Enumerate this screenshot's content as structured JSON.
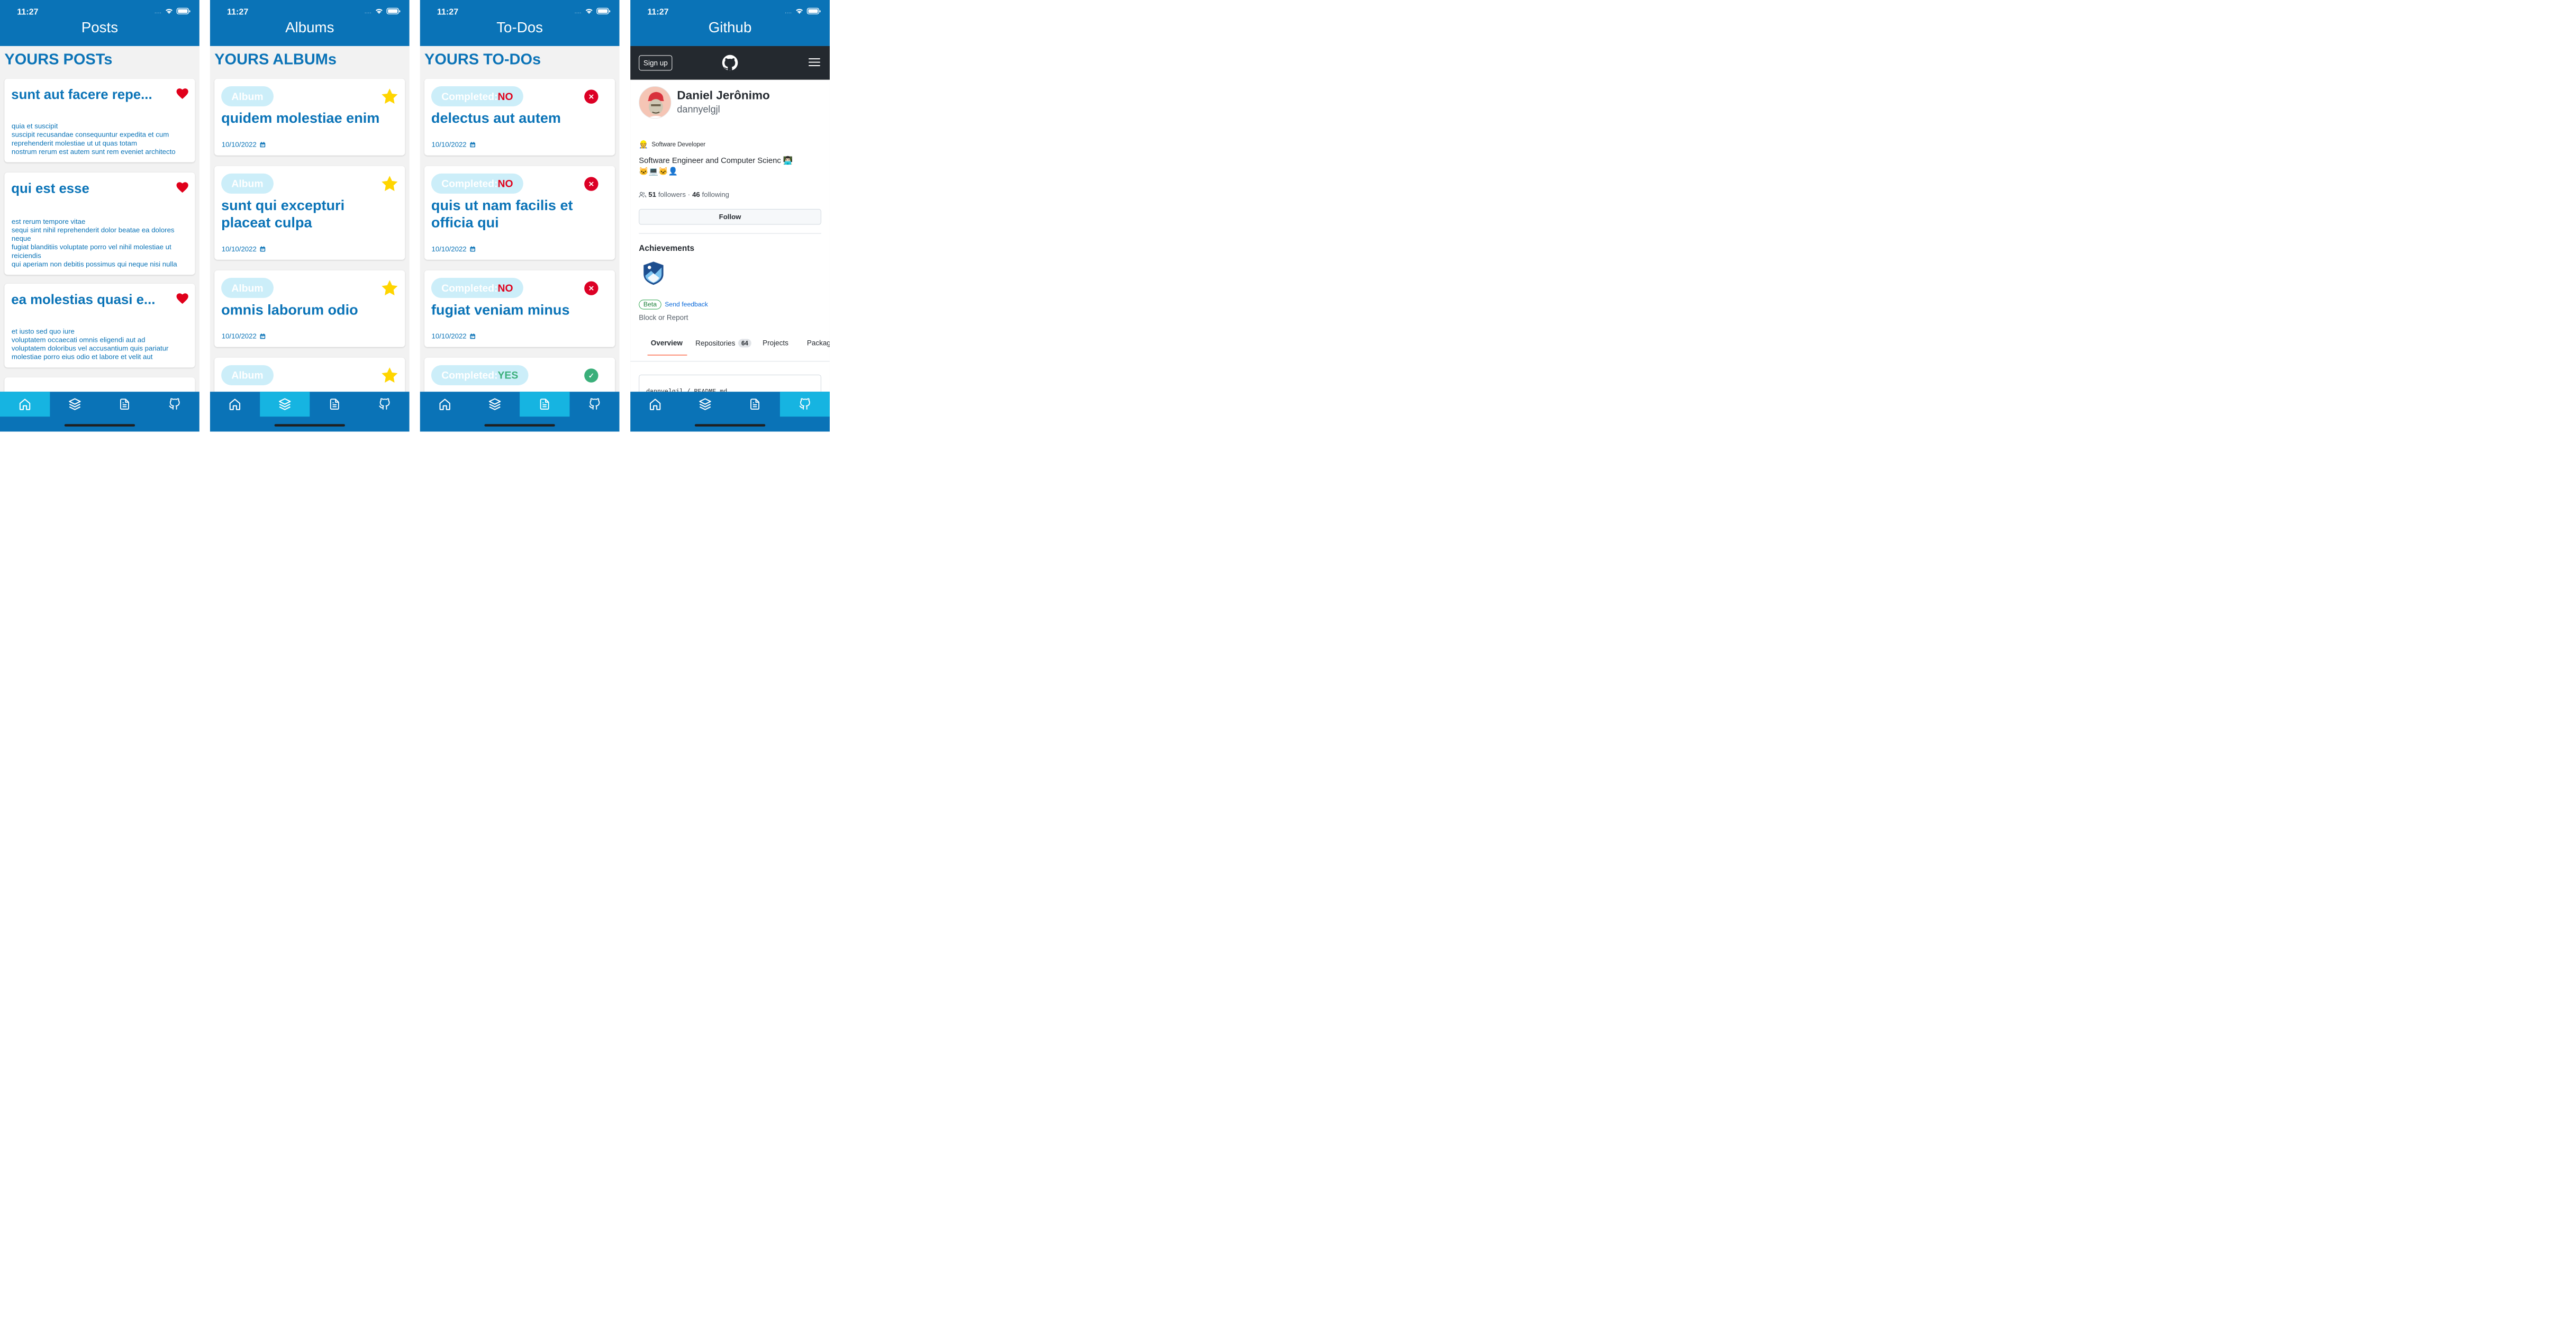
{
  "status": {
    "time": "11:27"
  },
  "posts_screen": {
    "title": "Posts",
    "section": "YOURS POSTs",
    "items": [
      {
        "title": "sunt aut facere repe...",
        "body": [
          "quia et suscipit",
          "suscipit recusandae consequuntur expedita et cum",
          "reprehenderit molestiae ut ut quas totam",
          "nostrum rerum est autem sunt rem eveniet architecto"
        ]
      },
      {
        "title": "qui est esse",
        "body": [
          "est rerum tempore vitae",
          "sequi sint nihil reprehenderit dolor beatae ea dolores",
          "neque",
          "fugiat blanditiis voluptate porro vel nihil molestiae ut",
          "reiciendis",
          "qui aperiam non debitis possimus qui neque nisi nulla"
        ]
      },
      {
        "title": "ea molestias quasi e...",
        "body": [
          "et iusto sed quo iure",
          "voluptatem occaecati omnis eligendi aut ad",
          "voluptatem doloribus vel accusantium quis pariatur",
          "molestiae porro eius odio et labore et velit aut"
        ]
      }
    ]
  },
  "albums_screen": {
    "title": "Albums",
    "section": "YOURS ALBUMs",
    "badge_label": "Album",
    "items": [
      {
        "title": "quidem molestiae enim",
        "date": "10/10/2022"
      },
      {
        "title": "sunt qui excepturi placeat culpa",
        "date": "10/10/2022"
      },
      {
        "title": "omnis laborum odio",
        "date": "10/10/2022"
      },
      {
        "title": "",
        "date": ""
      }
    ]
  },
  "todos_screen": {
    "title": "To-Dos",
    "section": "YOURS TO-DOs",
    "completed_label": "Completed: ",
    "items": [
      {
        "status": "NO",
        "title": "delectus aut autem",
        "date": "10/10/2022"
      },
      {
        "status": "NO",
        "title": "quis ut nam facilis et officia qui",
        "date": "10/10/2022"
      },
      {
        "status": "NO",
        "title": "fugiat veniam minus",
        "date": "10/10/2022"
      },
      {
        "status": "YES",
        "title": "",
        "date": ""
      }
    ]
  },
  "github_screen": {
    "title": "Github",
    "signup": "Sign up",
    "name": "Daniel Jerônimo",
    "username": "dannyelgjl",
    "status_emoji": "👷",
    "status_text": "Software Developer",
    "bio_line1": "Software Engineer and Computer Scienc 👨🏻‍💻",
    "bio_line2": "🐱💻🐱👤",
    "followers": "51",
    "followers_label": "followers",
    "dot": "·",
    "following": "46",
    "following_label": "following",
    "follow_button": "Follow",
    "achievements_title": "Achievements",
    "beta": "Beta",
    "send_feedback": "Send feedback",
    "block_report": "Block or Report",
    "tabs": {
      "overview": "Overview",
      "repositories": "Repositories",
      "repositories_count": "64",
      "projects": "Projects",
      "packages": "Packag"
    },
    "readme_path": "dannyelgjl / README.md"
  },
  "tab_icons": [
    "home-icon",
    "layers-icon",
    "document-icon",
    "github-icon"
  ],
  "colors": {
    "primary": "#0a73b7",
    "tab_active": "#16b4e1",
    "heart": "#e0001b",
    "star": "#ffd500",
    "completed_no": "#e0001b",
    "completed_yes": "#3aaf7a",
    "badge_bg": "#cceef9"
  }
}
